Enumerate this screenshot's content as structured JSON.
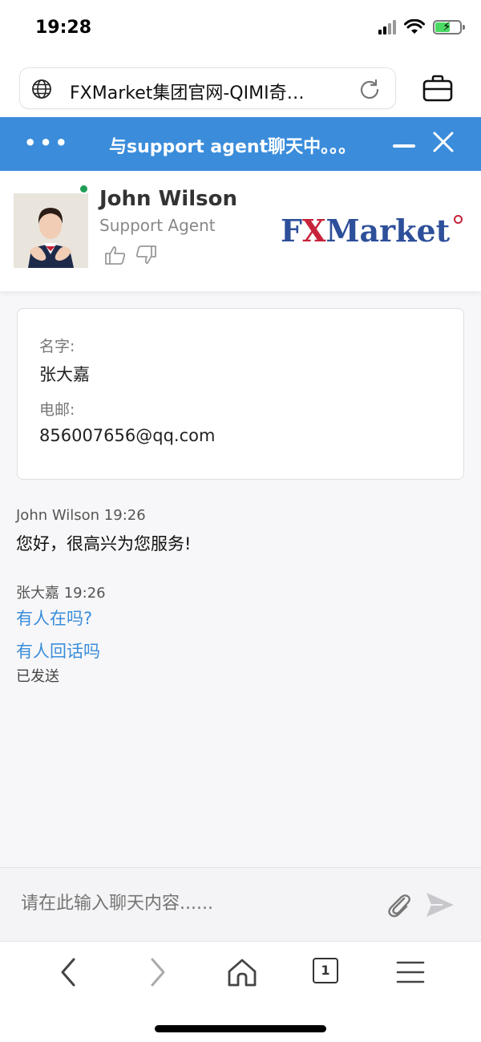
{
  "status_bar": {
    "time": "19:28",
    "battery_level": 0.6,
    "icons": [
      "signal-icon",
      "wifi-icon",
      "battery-charging-icon"
    ]
  },
  "browser": {
    "url_title": "FXMarket集团官网-QIMI奇…",
    "icons": [
      "globe-icon",
      "reload-icon",
      "briefcase-icon"
    ]
  },
  "chat_header": {
    "menu_dots": "•••",
    "title": "与support agent聊天中。。。",
    "accent_color": "#3b8ddb"
  },
  "agent": {
    "name": "John Wilson",
    "role": "Support Agent",
    "online": true,
    "logo": {
      "part1": "F",
      "part2": "X",
      "part3": "Market"
    }
  },
  "visitor_form": {
    "name_label": "名字:",
    "name_value": "张大嘉",
    "email_label": "电邮:",
    "email_value": "856007656@qq.com"
  },
  "messages": [
    {
      "sender": "John Wilson",
      "time": "19:26",
      "text": "您好，很高兴为您服务!"
    },
    {
      "sender": "张大嘉",
      "time": "19:26",
      "lines": [
        "有人在吗?",
        "有人回话吗"
      ],
      "status": "已发送"
    }
  ],
  "input": {
    "placeholder": "请在此输入聊天内容......"
  },
  "bottom_nav": {
    "tab_count": "1",
    "icons": [
      "back-icon",
      "forward-icon",
      "home-icon",
      "tabs-icon",
      "menu-icon"
    ]
  }
}
